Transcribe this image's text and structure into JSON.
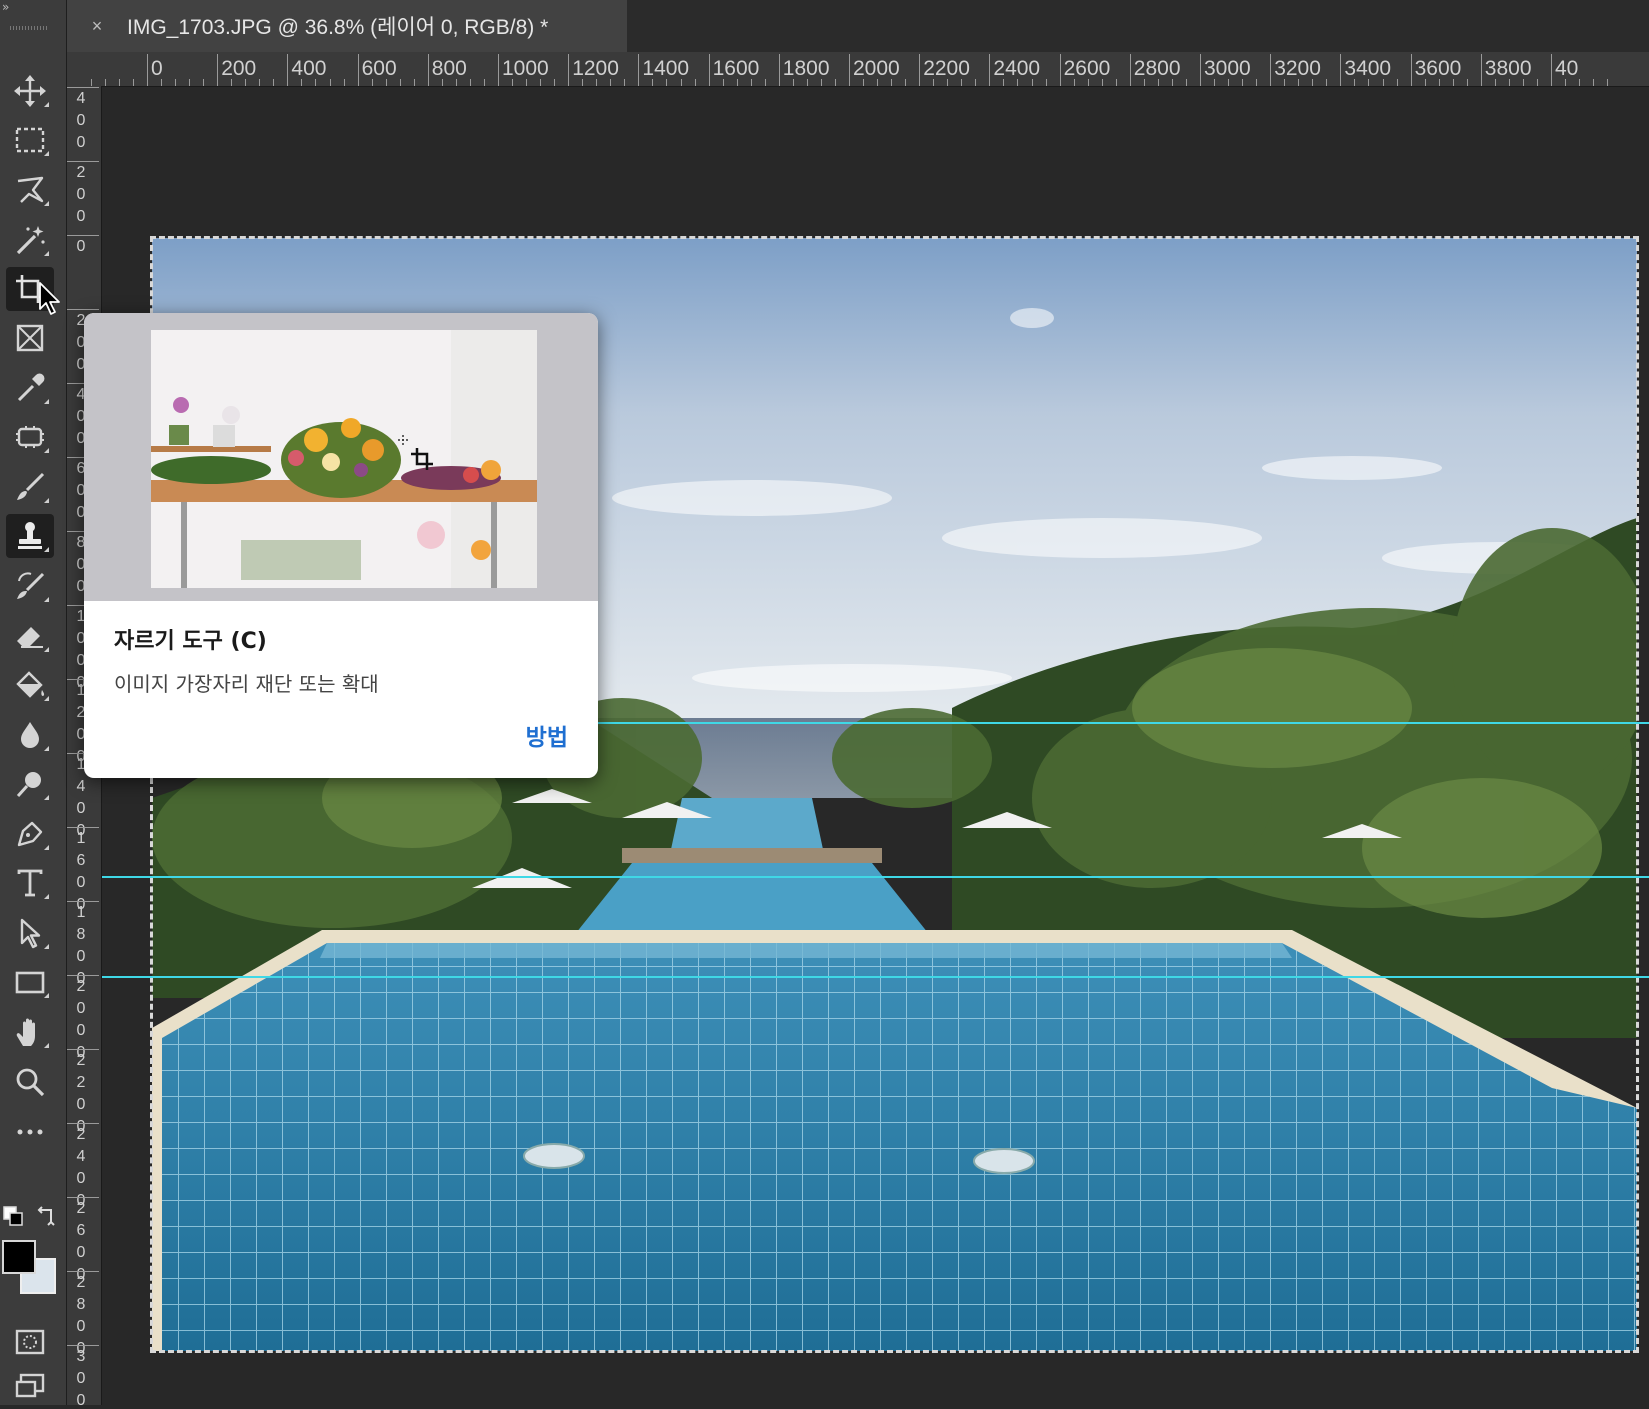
{
  "document_tab": {
    "close_glyph": "×",
    "title": "IMG_1703.JPG @ 36.8% (레이어 0, RGB/8) *"
  },
  "ruler_top_labels": [
    "0",
    "200",
    "400",
    "600",
    "800",
    "1000",
    "1200",
    "1400",
    "1600",
    "1800",
    "2000",
    "2200",
    "2400",
    "2600",
    "2800",
    "3000",
    "3200",
    "3400",
    "3600",
    "3800",
    "40"
  ],
  "ruler_left_labels": [
    "400",
    "200",
    "0",
    "200",
    "400",
    "600",
    "800",
    "1000",
    "1200",
    "1400",
    "1600",
    "1800",
    "2000",
    "2200",
    "2400",
    "2600",
    "2800",
    "3000"
  ],
  "toolbar": {
    "collapse_glyph": "»",
    "tools": [
      {
        "name": "move-tool",
        "icon": "move-icon"
      },
      {
        "name": "rectangular-marquee-tool",
        "icon": "marquee-icon"
      },
      {
        "name": "lasso-tool",
        "icon": "lasso-icon"
      },
      {
        "name": "magic-wand-tool",
        "icon": "magic-wand-icon"
      },
      {
        "name": "crop-tool",
        "icon": "crop-icon"
      },
      {
        "name": "frame-tool",
        "icon": "frame-icon"
      },
      {
        "name": "eyedropper-tool",
        "icon": "eyedropper-icon"
      },
      {
        "name": "spot-healing-tool",
        "icon": "healing-icon"
      },
      {
        "name": "brush-tool",
        "icon": "brush-icon"
      },
      {
        "name": "clone-stamp-tool",
        "icon": "stamp-icon"
      },
      {
        "name": "history-brush-tool",
        "icon": "history-brush-icon"
      },
      {
        "name": "eraser-tool",
        "icon": "eraser-icon"
      },
      {
        "name": "paint-bucket-tool",
        "icon": "bucket-icon"
      },
      {
        "name": "blur-tool",
        "icon": "blur-drop-icon"
      },
      {
        "name": "dodge-tool",
        "icon": "dodge-icon"
      },
      {
        "name": "pen-tool",
        "icon": "pen-icon"
      },
      {
        "name": "type-tool",
        "icon": "type-icon"
      },
      {
        "name": "path-selection-tool",
        "icon": "arrow-icon"
      },
      {
        "name": "rectangle-tool",
        "icon": "rectangle-icon"
      },
      {
        "name": "hand-tool",
        "icon": "hand-icon"
      },
      {
        "name": "zoom-tool",
        "icon": "zoom-icon"
      },
      {
        "name": "edit-toolbar",
        "icon": "more-icon"
      }
    ],
    "foreground_color": "#000000",
    "background_color": "#dbe4ec"
  },
  "tooltip": {
    "title": "자르기 도구 (C)",
    "description": "이미지 가장자리 재단 또는 확대",
    "link": "방법"
  },
  "colors": {
    "guide": "#3fd8e6",
    "link": "#1f6fd1"
  }
}
